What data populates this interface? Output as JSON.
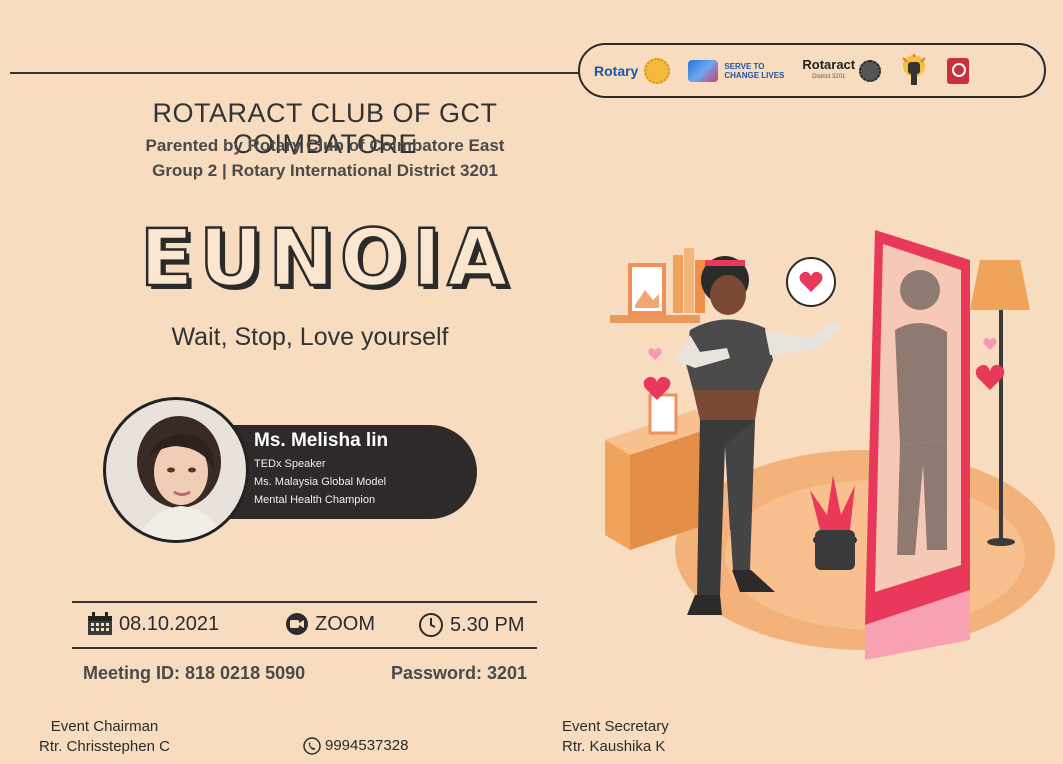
{
  "logos": {
    "rotary": "Rotary",
    "serve_line1": "SERVE TO",
    "serve_line2": "CHANGE LIVES",
    "rotaract": "Rotaract",
    "rotaract_sub": "District 3201"
  },
  "header": {
    "club_name": "ROTARACT CLUB OF GCT COIMBATORE",
    "parented_by": "Parented by Rotary Club of Coimbatore East",
    "group_district": "Group 2 | Rotary International District  3201"
  },
  "event": {
    "title": "EUNOIA",
    "tagline": "Wait, Stop, Love yourself"
  },
  "speaker": {
    "name": "Ms. Melisha lin",
    "roles": [
      "TEDx Speaker",
      "Ms. Malaysia Global Model",
      "Mental Health Champion"
    ]
  },
  "details": {
    "date": "08.10.2021",
    "platform": "ZOOM",
    "time": "5.30 PM",
    "meeting_id": "Meeting ID: 818 0218 5090",
    "password": "Password: 3201"
  },
  "footer": {
    "chairman_label": "Event Chairman",
    "chairman_name": "Rtr. Chrisstephen C",
    "phone": "9994537328",
    "secretary_label": "Event Secretary",
    "secretary_name": "Rtr. Kaushika K"
  },
  "icons": {
    "calendar": "calendar-icon",
    "zoom": "zoom-camera-icon",
    "clock": "clock-icon",
    "phone": "phone-icon",
    "heart": "heart-icon"
  },
  "colors": {
    "background": "#f8dcc0",
    "dark": "#2b2b2b",
    "accent_pink": "#e8395b",
    "accent_orange": "#f0a35a"
  }
}
